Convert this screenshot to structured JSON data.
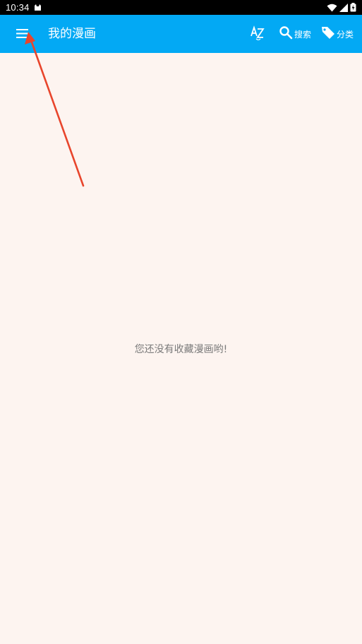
{
  "status_bar": {
    "time": "10:34",
    "icons": [
      "cat-notification-icon",
      "wifi-icon",
      "signal-icon",
      "battery-charging-icon"
    ]
  },
  "app_bar": {
    "menu_icon": "hamburger-menu-icon",
    "title": "我的漫画",
    "actions": {
      "sort": {
        "icon": "sort-az-icon",
        "label": ""
      },
      "search": {
        "icon": "search-icon",
        "label": "搜索"
      },
      "category": {
        "icon": "tag-icon",
        "label": "分类"
      }
    }
  },
  "main": {
    "empty_message": "您还没有收藏漫画哟!"
  },
  "annotation": {
    "arrow_color": "#e8452c",
    "points_to": "hamburger-menu-icon"
  },
  "colors": {
    "app_bar": "#03a9f4",
    "background": "#fdf4f0",
    "status_bar": "#000000"
  }
}
